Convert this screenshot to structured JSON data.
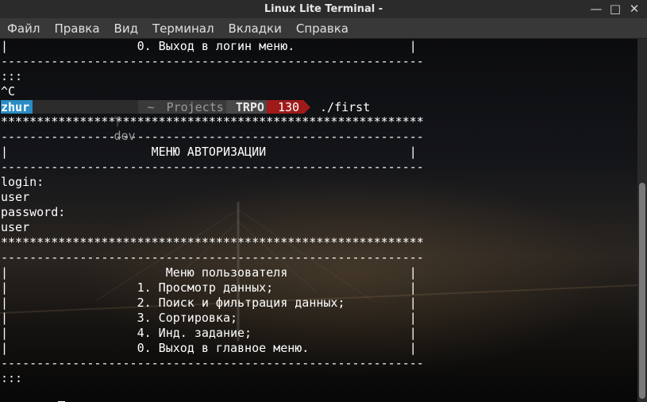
{
  "window": {
    "title": "Linux Lite Terminal -",
    "minimize_icon": "minimize-icon",
    "maximize_icon": "maximize-icon",
    "close_icon": "close-icon",
    "minimize_glyph": "—",
    "maximize_glyph": "□",
    "close_glyph": "✕"
  },
  "menu": [
    "Файл",
    "Правка",
    "Вид",
    "Терминал",
    "Вкладки",
    "Справка"
  ],
  "terminal": {
    "lines_before": [
      "|                  0. Выход в логин меню.                |",
      "-----------------------------------------------------------",
      ":::",
      "^C"
    ],
    "prompt": {
      "user": "zhur",
      "git_icon": "ᛘ",
      "git_branch": "dev",
      "dir_home": "~",
      "dir_1": "Projects",
      "dir_2": "TRPO",
      "exit_code": "130",
      "command": "./first"
    },
    "lines_after": [
      "***********************************************************",
      "-----------------------------------------------------------",
      "|                    МЕНЮ АВТОРИЗАЦИИ                    |",
      "-----------------------------------------------------------",
      "login:",
      "user",
      "password:",
      "user",
      "***********************************************************",
      "-----------------------------------------------------------",
      "|                      Меню пользователя                 |",
      "|                  1. Просмотр данных;                   |",
      "|                  2. Поиск и фильтрация данных;         |",
      "|                  3. Сортировка;                        |",
      "|                  4. Инд. задание;                      |",
      "|                  0. Выход в главное меню.              |",
      "-----------------------------------------------------------",
      ":::"
    ]
  },
  "colors": {
    "user_segment": "#2a8cc4",
    "error_segment": "#a01a1a",
    "titlebar": "#2b2b2b",
    "menubar": "#383838"
  }
}
